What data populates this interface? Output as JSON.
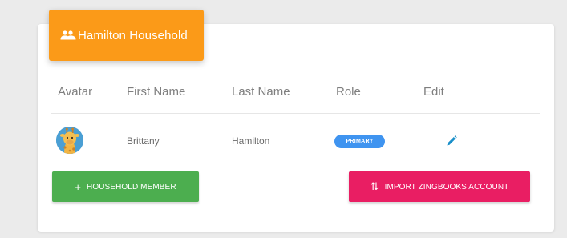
{
  "header": {
    "title": "Hamilton Household",
    "icon": "group-icon"
  },
  "table": {
    "columns": [
      "Avatar",
      "First Name",
      "Last Name",
      "Role",
      "Edit"
    ],
    "rows": [
      {
        "avatar_icon": "giraffe-avatar",
        "first_name": "Brittany",
        "last_name": "Hamilton",
        "role": "PRIMARY",
        "edit_icon": "pencil-icon"
      }
    ]
  },
  "buttons": {
    "add_member": {
      "label": "HOUSEHOLD MEMBER",
      "glyph": "+",
      "color": "#4cae4f"
    },
    "import": {
      "label": "IMPORT ZINGBOOKS ACCOUNT",
      "glyph": "⇅",
      "color": "#e91e63"
    }
  },
  "colors": {
    "header_orange": "#fb9a18",
    "primary_badge": "#3f94f0",
    "edit_icon": "#1a8fc9"
  }
}
